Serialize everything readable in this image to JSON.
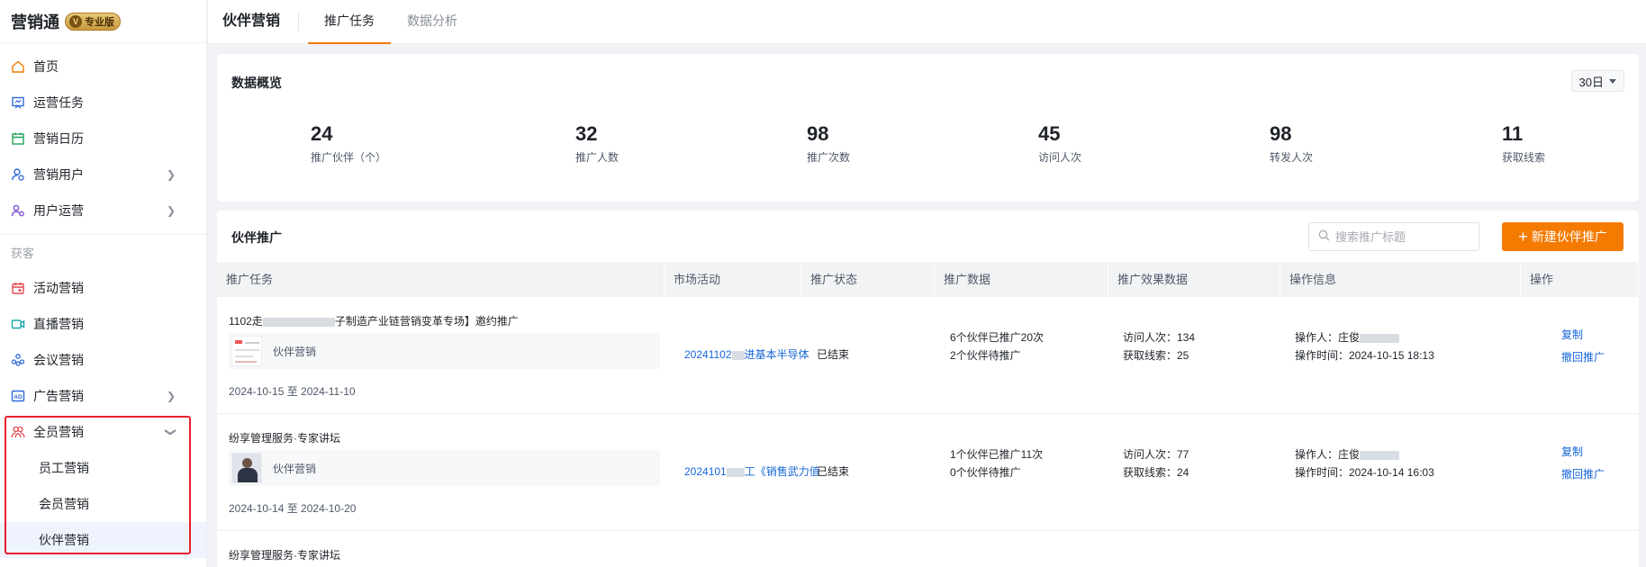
{
  "app": {
    "name": "营销通",
    "edition_badge": "专业版"
  },
  "sidebar": {
    "items": [
      {
        "label": "首页",
        "icon": "home-icon"
      },
      {
        "label": "运营任务",
        "icon": "task-board-icon"
      },
      {
        "label": "营销日历",
        "icon": "calendar-icon"
      },
      {
        "label": "营销用户",
        "icon": "user-target-icon",
        "expandable": true
      },
      {
        "label": "用户运营",
        "icon": "users-gear-icon",
        "expandable": true
      }
    ],
    "section_label": "获客",
    "acquire_items": [
      {
        "label": "活动营销",
        "icon": "activity-icon"
      },
      {
        "label": "直播营销",
        "icon": "live-icon"
      },
      {
        "label": "会议营销",
        "icon": "meeting-icon"
      },
      {
        "label": "广告营销",
        "icon": "ad-icon",
        "expandable": true
      },
      {
        "label": "全员营销",
        "icon": "all-staff-icon",
        "expanded": true
      }
    ],
    "sub_items": [
      {
        "label": "员工营销"
      },
      {
        "label": "会员营销"
      },
      {
        "label": "伙伴营销",
        "active": true
      }
    ]
  },
  "header": {
    "title": "伙伴营销",
    "tabs": [
      {
        "label": "推广任务",
        "active": true
      },
      {
        "label": "数据分析"
      }
    ]
  },
  "overview": {
    "title": "数据概览",
    "range": "30日",
    "stats": [
      {
        "value": "24",
        "label": "推广伙伴（个）"
      },
      {
        "value": "32",
        "label": "推广人数"
      },
      {
        "value": "98",
        "label": "推广次数"
      },
      {
        "value": "45",
        "label": "访问人次"
      },
      {
        "value": "98",
        "label": "转发人次"
      },
      {
        "value": "11",
        "label": "获取线索"
      }
    ]
  },
  "partner_promo": {
    "title": "伙伴推广",
    "search_placeholder": "搜索推广标题",
    "new_button": "新建伙伴推广",
    "columns": [
      "推广任务",
      "市场活动",
      "推广状态",
      "推广数据",
      "推广效果数据",
      "操作信息",
      "操作"
    ],
    "rows": [
      {
        "title_a": "1102走",
        "title_b": "子制造产业链营销变革专场】邀约推广",
        "thumb_label": "伙伴营销",
        "dates": "2024-10-15 至 2024-11-10",
        "campaign_a": "20241102",
        "campaign_b": "进基本半导体",
        "status": "已结束",
        "promo_line1": "6个伙伴已推广20次",
        "promo_line2": "2个伙伴待推广",
        "effect_line1": "访问人次：134",
        "effect_line2": "获取线索：25",
        "operator": "操作人：庄俊",
        "op_time": "操作时间：2024-10-15 18:13",
        "action1": "复制",
        "action2": "撤回推广"
      },
      {
        "title_a": "纷享管理服务·专家讲坛",
        "title_b": "",
        "thumb_label": "伙伴营销",
        "dates": "2024-10-14 至 2024-10-20",
        "campaign_a": "2024101",
        "campaign_b": "工《销售武力值",
        "status": "已结束",
        "promo_line1": "1个伙伴已推广11次",
        "promo_line2": "0个伙伴待推广",
        "effect_line1": "访问人次：77",
        "effect_line2": "获取线索：24",
        "operator": "操作人：庄俊",
        "op_time": "操作时间：2024-10-14 16:03",
        "action1": "复制",
        "action2": "撤回推广"
      },
      {
        "title_a": "纷享管理服务·专家讲坛",
        "title_b": ""
      }
    ]
  },
  "colors": {
    "accent": "#f57a00",
    "link": "#1665d8",
    "highlight_box": "#e8202e"
  }
}
